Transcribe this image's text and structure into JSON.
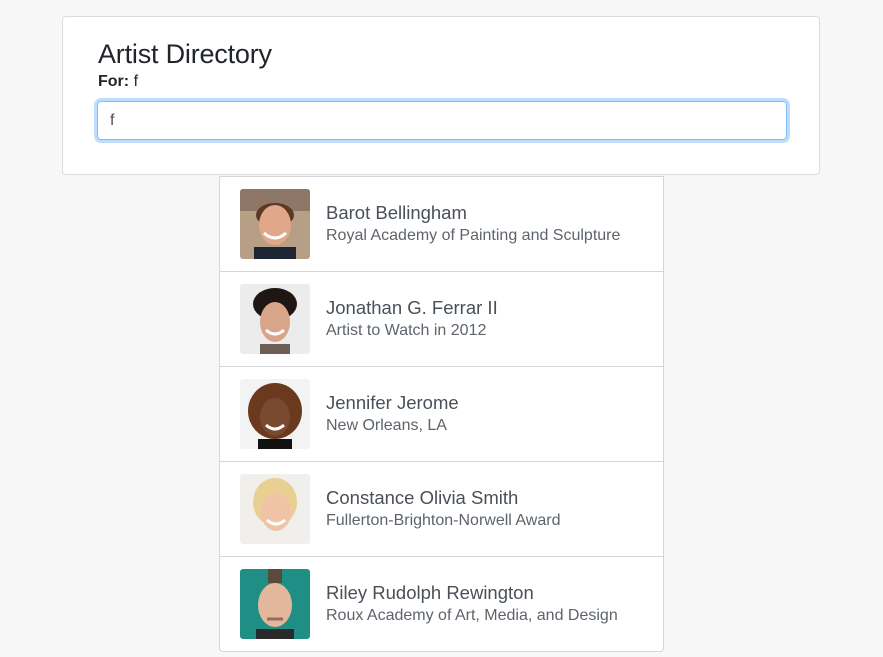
{
  "header": {
    "title": "Artist Directory",
    "for_label": "For:",
    "query": "f"
  },
  "search": {
    "value": "f",
    "placeholder": ""
  },
  "artists": [
    {
      "name": "Barot Bellingham",
      "reknown": "Royal Academy of Painting and Sculpture",
      "icon": "barot-bellingham-photo"
    },
    {
      "name": "Jonathan G. Ferrar II",
      "reknown": "Artist to Watch in 2012",
      "icon": "jonathan-ferrar-photo"
    },
    {
      "name": "Jennifer Jerome",
      "reknown": "New Orleans, LA",
      "icon": "jennifer-jerome-photo"
    },
    {
      "name": "Constance Olivia Smith",
      "reknown": "Fullerton-Brighton-Norwell Award",
      "icon": "constance-smith-photo"
    },
    {
      "name": "Riley Rudolph Rewington",
      "reknown": "Roux Academy of Art, Media, and Design",
      "icon": "riley-rewington-photo"
    }
  ],
  "colors": {
    "focus_border": "#80bdff",
    "name_text": "#495057",
    "page_bg": "#f7f7f8"
  }
}
